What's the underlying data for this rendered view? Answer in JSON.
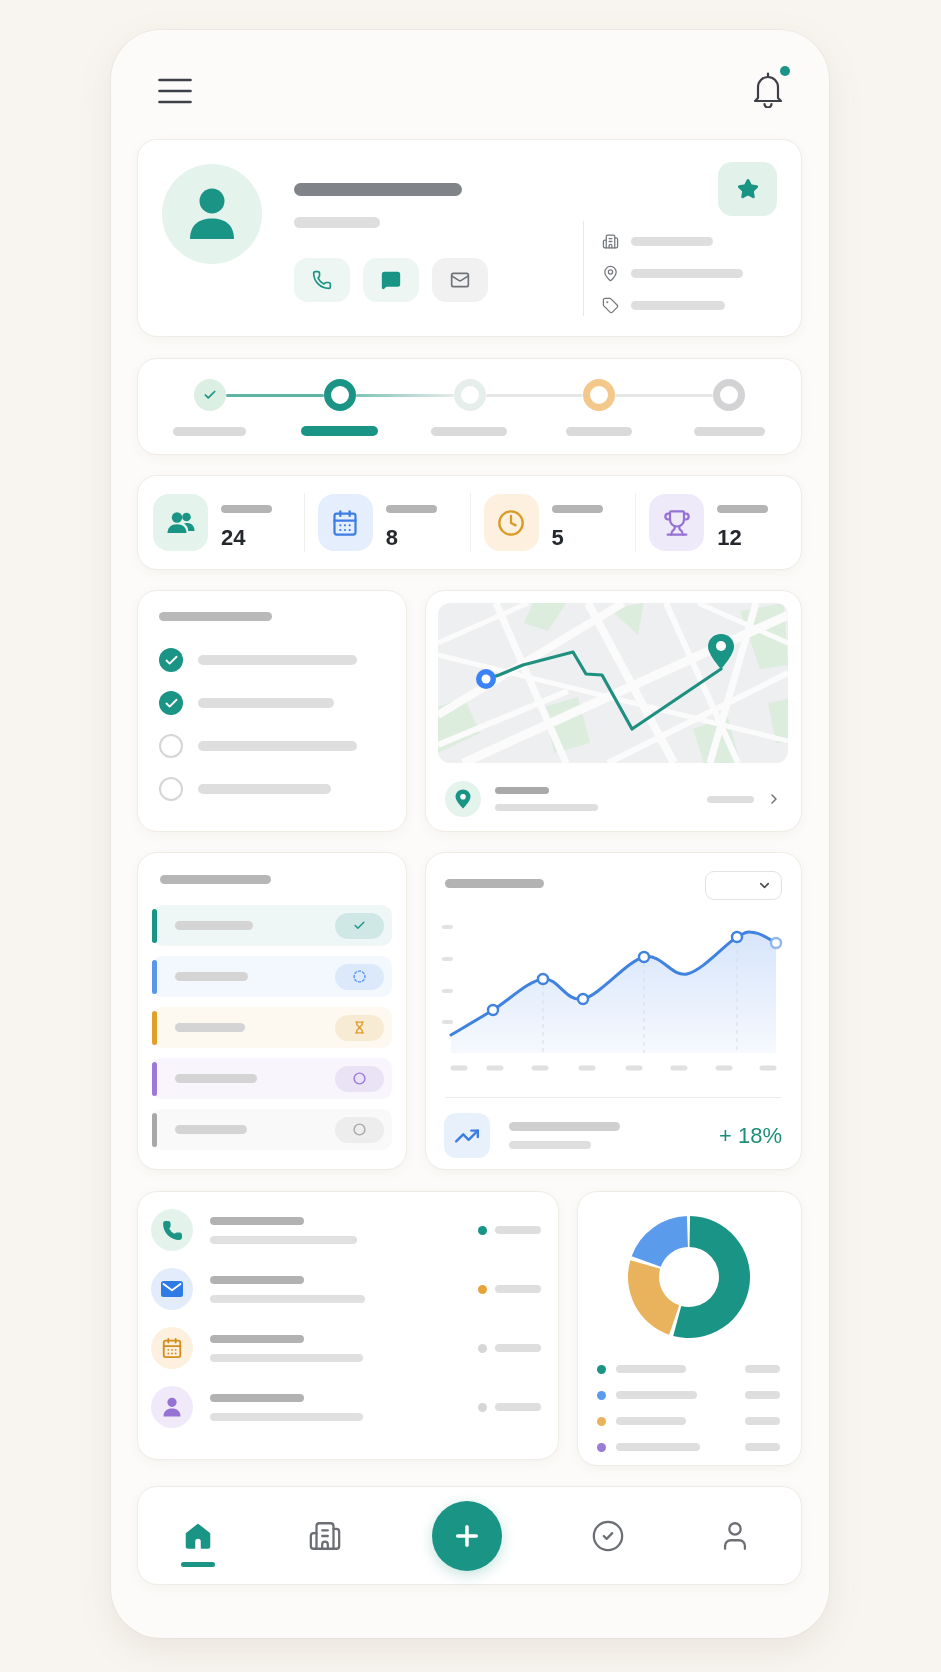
{
  "header": {
    "notifications": {
      "unread": true
    }
  },
  "profile": {
    "favorite": true,
    "actions": [
      {
        "kind": "phone"
      },
      {
        "kind": "message"
      },
      {
        "kind": "mail"
      }
    ],
    "details": [
      {
        "kind": "building"
      },
      {
        "kind": "location"
      },
      {
        "kind": "tag"
      }
    ]
  },
  "stepper": {
    "steps": [
      {
        "kind": "check",
        "selected": false,
        "color": "#dcefe3"
      },
      {
        "kind": "ring",
        "selected": true,
        "color": "#1a9485"
      },
      {
        "kind": "ring",
        "selected": false,
        "color": "#e6eeec"
      },
      {
        "kind": "ring",
        "selected": false,
        "color": "#f3c88a"
      },
      {
        "kind": "ring",
        "selected": false,
        "color": "#d3d3d5"
      }
    ]
  },
  "stats": [
    {
      "kind": "people",
      "value": "24"
    },
    {
      "kind": "calendar",
      "value": "8"
    },
    {
      "kind": "clock",
      "value": "5"
    },
    {
      "kind": "trophy",
      "value": "12"
    }
  ],
  "tasks": {
    "items": [
      {
        "checked": true
      },
      {
        "checked": true
      },
      {
        "checked": false
      },
      {
        "checked": false
      }
    ]
  },
  "map_card": {
    "route": true
  },
  "status_list": {
    "items": [
      {
        "kind": "done",
        "color": "#1a9485"
      },
      {
        "kind": "in_progress",
        "color": "#5a96ea"
      },
      {
        "kind": "waiting",
        "color": "#dfa02c"
      },
      {
        "kind": "open",
        "color": "#9a7ad6"
      },
      {
        "kind": "open",
        "color": "#a8a8a8"
      }
    ]
  },
  "trend_chart": {
    "dropdown": {
      "expanded": false
    },
    "summary": {
      "positive": true,
      "change": "+ 18%"
    }
  },
  "contacts": [
    {
      "kind": "phone",
      "color": "#1a9485"
    },
    {
      "kind": "mail",
      "color": "#e5a33a"
    },
    {
      "kind": "calendar",
      "color": "#d6d6d6"
    },
    {
      "kind": "person",
      "color": "#d6d6d6"
    }
  ],
  "breakdown": {
    "legend": [
      {
        "color": "#1a9485"
      },
      {
        "color": "#5b9bec"
      },
      {
        "color": "#e9b25c"
      },
      {
        "color": "#9a7bd6"
      }
    ]
  },
  "bottom_nav": {
    "items": [
      {
        "kind": "home",
        "selected": true
      },
      {
        "kind": "buildings",
        "selected": false
      },
      {
        "kind": "add",
        "selected": false
      },
      {
        "kind": "tasks",
        "selected": false
      },
      {
        "kind": "profile",
        "selected": false
      }
    ]
  }
}
